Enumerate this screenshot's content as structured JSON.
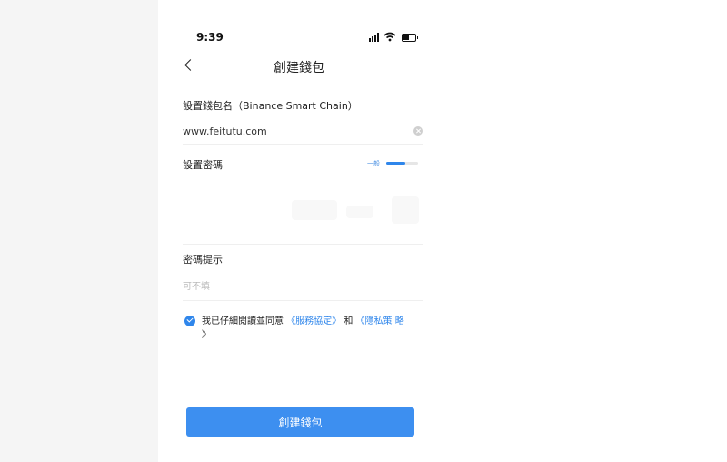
{
  "status_bar": {
    "time": "9:39"
  },
  "nav": {
    "title": "創建錢包"
  },
  "wallet_name": {
    "label": "設置錢包名（Binance Smart Chain）",
    "value": "www.feitutu.com"
  },
  "password": {
    "label": "設置密碼",
    "strength_text": "一般",
    "strength_level": 0.6
  },
  "hint": {
    "label": "密碼提示",
    "placeholder": "可不填"
  },
  "agreement": {
    "checked": true,
    "prefix": "我已仔細閱讀並同意",
    "link1": "《服務協定》",
    "middle": " 和 ",
    "link2_start": "《隱私策",
    "link2_end": "略",
    "suffix": "》"
  },
  "create_button": {
    "label": "創建錢包"
  },
  "colors": {
    "accent": "#2f86eb",
    "button": "#3d8ff0",
    "side_bg": "#f5f5f5"
  }
}
